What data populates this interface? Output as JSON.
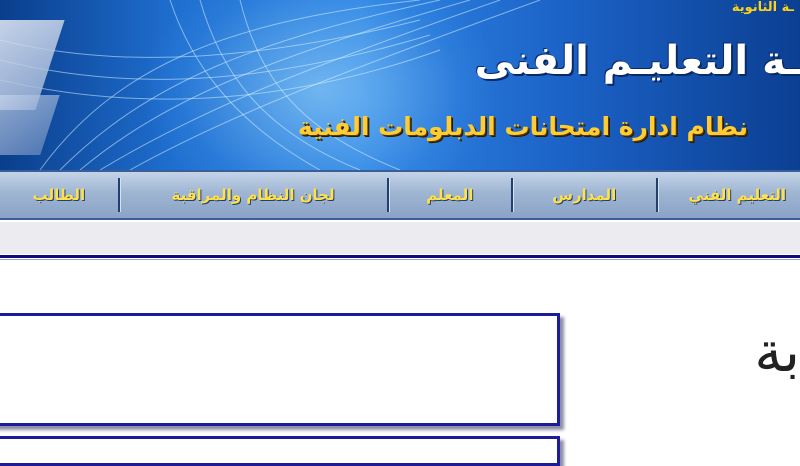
{
  "banner": {
    "top_text": "ـة الثانوية",
    "title": "ـة التعليـم الفنى",
    "subtitle": "نظام ادارة امتحانات الدبلومات الفنية"
  },
  "nav": {
    "items": [
      {
        "label": "التعليم الفني"
      },
      {
        "label": "المدارس"
      },
      {
        "label": "المعلم"
      },
      {
        "label": "لجان النظام والمراقبة"
      },
      {
        "label": "الطالب"
      }
    ]
  },
  "content": {
    "side_text": "بة"
  },
  "colors": {
    "nav_text": "#ffe14a",
    "panel_border": "#1d1d9a",
    "rule": "#0b0b7a",
    "banner_blue": "#1f6fd0"
  }
}
